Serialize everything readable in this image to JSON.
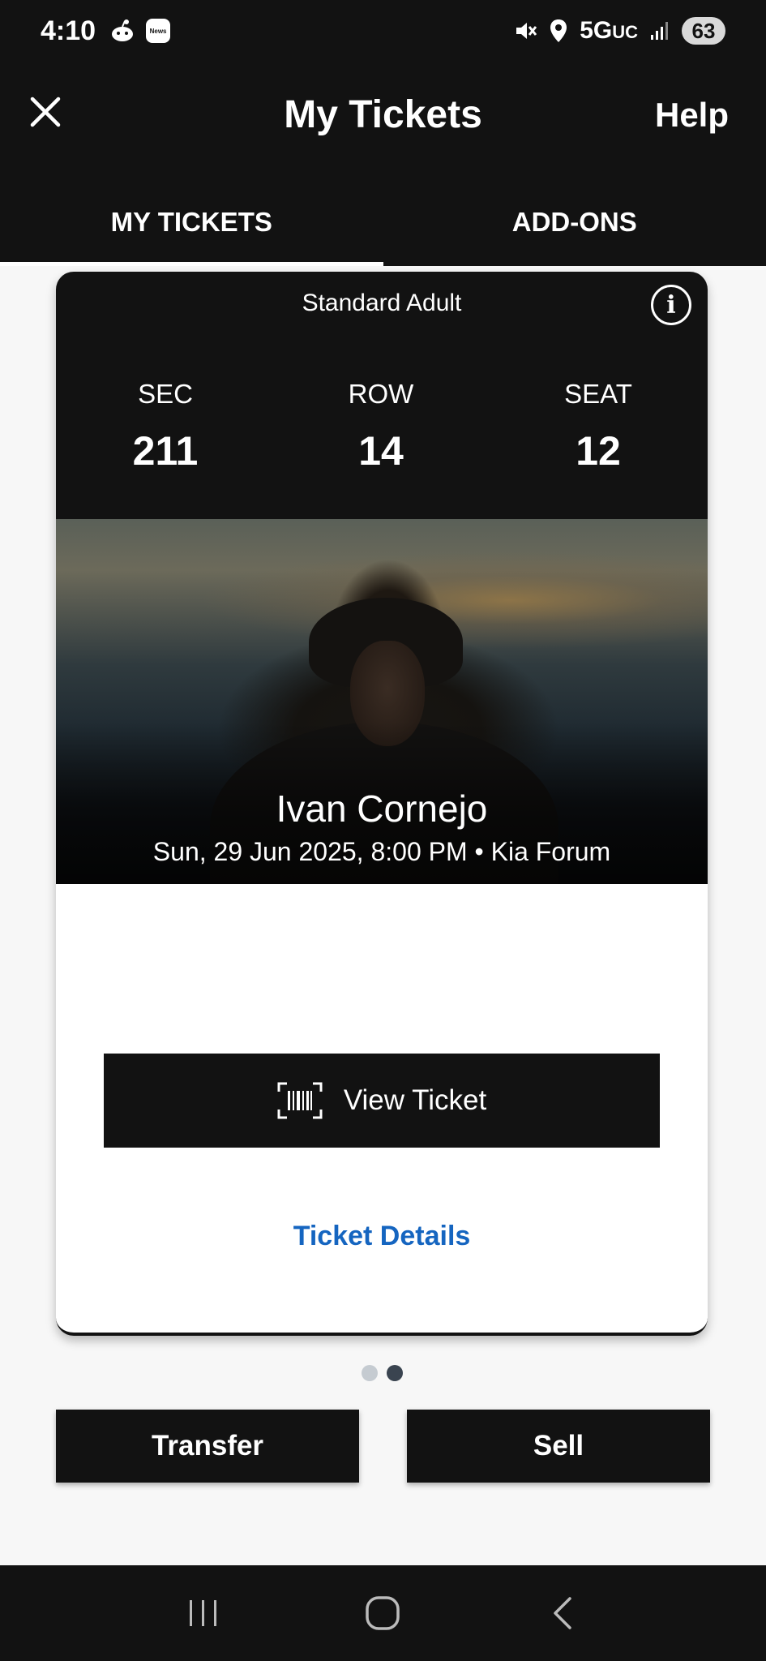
{
  "status_bar": {
    "time": "4:10",
    "news_label": "News",
    "network": "5G",
    "network_suffix": "UC",
    "battery": "63"
  },
  "header": {
    "title": "My Tickets",
    "help_label": "Help"
  },
  "tabs": [
    {
      "label": "MY TICKETS",
      "active": true
    },
    {
      "label": "ADD-ONS",
      "active": false
    }
  ],
  "ticket": {
    "type": "Standard Adult",
    "info_symbol": "i",
    "sec_label": "SEC",
    "sec_value": "211",
    "row_label": "ROW",
    "row_value": "14",
    "seat_label": "SEAT",
    "seat_value": "12",
    "event_name": "Ivan Cornejo",
    "event_meta": "Sun, 29 Jun 2025, 8:00 PM • Kia Forum",
    "view_ticket_label": "View Ticket",
    "details_link": "Ticket Details"
  },
  "pager": {
    "count": 2,
    "active_index": 1
  },
  "actions": {
    "transfer_label": "Transfer",
    "sell_label": "Sell"
  },
  "icons": {
    "close": "close-icon",
    "info": "info-icon",
    "barcode": "barcode-icon",
    "recents": "recents-icon",
    "home": "home-icon",
    "back": "back-icon"
  },
  "colors": {
    "bar_background": "#121212",
    "page_background": "#f7f7f7",
    "link_blue": "#1565c0",
    "pager_inactive": "#c5cbd1",
    "pager_active": "#3a4450"
  }
}
